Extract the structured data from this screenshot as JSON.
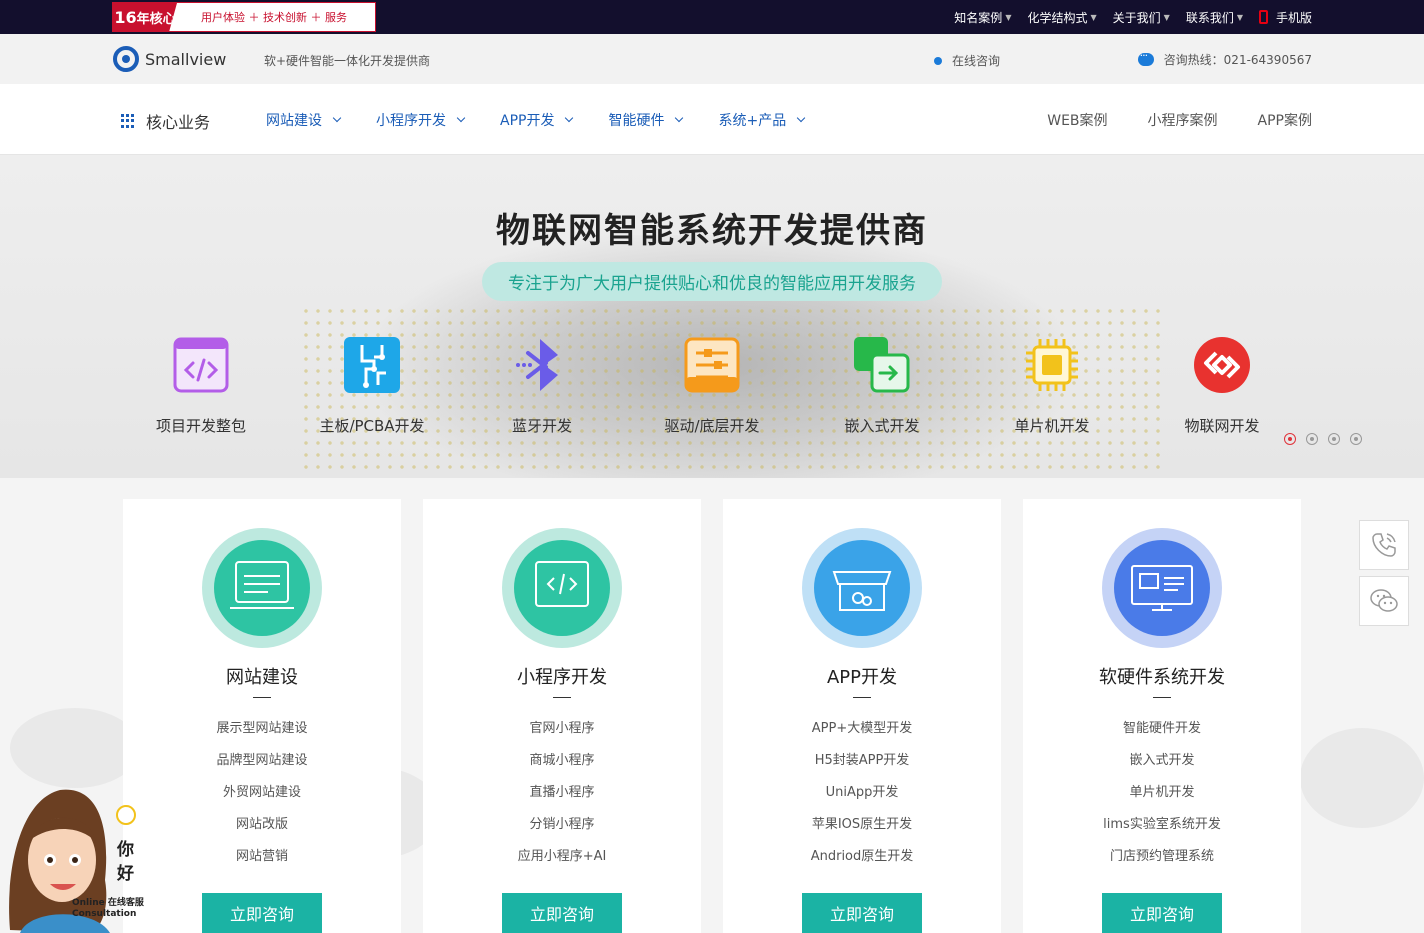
{
  "topbar": {
    "promo_years": "16",
    "promo_years_suffix": "年核心",
    "promo_text": "用户体验 ＋ 技术创新 ＋ 服务",
    "links": [
      "知名案例",
      "化学结构式",
      "关于我们",
      "联系我们"
    ],
    "mobile": "手机版"
  },
  "logobar": {
    "brand": "Smallview",
    "slogan": "软+硬件智能一体化开发提供商",
    "online": "在线咨询",
    "hotline": "咨询热线：021-64390567"
  },
  "nav": {
    "core": "核心业务",
    "items": [
      "网站建设",
      "小程序开发",
      "APP开发",
      "智能硬件",
      "系统+产品"
    ],
    "cases": [
      "WEB案例",
      "小程序案例",
      "APP案例"
    ]
  },
  "banner": {
    "title": "物联网智能系统开发提供商",
    "subtitle": "专注于为广大用户提供贴心和优良的智能应用开发服务",
    "features": [
      {
        "label": "项目开发整包",
        "icon": "code-icon",
        "color": "#b35de8"
      },
      {
        "label": "主板/PCBA开发",
        "icon": "circuit-board-icon",
        "color": "#1ea7e8"
      },
      {
        "label": "蓝牙开发",
        "icon": "bluetooth-icon",
        "color": "#6a5ce8"
      },
      {
        "label": "驱动/底层开发",
        "icon": "driver-sliders-icon",
        "color": "#f59a1b"
      },
      {
        "label": "嵌入式开发",
        "icon": "embedded-icon",
        "color": "#27b84a"
      },
      {
        "label": "单片机开发",
        "icon": "chip-icon",
        "color": "#f2c21b"
      },
      {
        "label": "物联网开发",
        "icon": "iot-link-icon",
        "color": "#e8322f"
      }
    ]
  },
  "services": [
    {
      "title": "网站建设",
      "items": [
        "展示型网站建设",
        "品牌型网站建设",
        "外贸网站建设",
        "网站改版",
        "网站营销"
      ],
      "button": "立即咨询",
      "icon": "website-icon",
      "color": "#2ec4a3"
    },
    {
      "title": "小程序开发",
      "items": [
        "官网小程序",
        "商城小程序",
        "直播小程序",
        "分销小程序",
        "应用小程序+AI"
      ],
      "button": "立即咨询",
      "icon": "miniprogram-code-icon",
      "color": "#2ec4a3"
    },
    {
      "title": "APP开发",
      "items": [
        "APP+大模型开发",
        "H5封装APP开发",
        "UniApp开发",
        "苹果IOS原生开发",
        "Andriod原生开发"
      ],
      "button": "立即咨询",
      "icon": "app-store-icon",
      "color": "#3aa3e8"
    },
    {
      "title": "软硬件系统开发",
      "items": [
        "智能硬件开发",
        "嵌入式开发",
        "单片机开发",
        "lims实验室系统开发",
        "门店预约管理系统"
      ],
      "button": "立即咨询",
      "icon": "system-screen-icon",
      "color": "#4a7be8"
    }
  ],
  "avatar": {
    "greeting": "你好",
    "label_en": "Online",
    "label_cn": "在线客服",
    "label_en2": "Consultation"
  }
}
